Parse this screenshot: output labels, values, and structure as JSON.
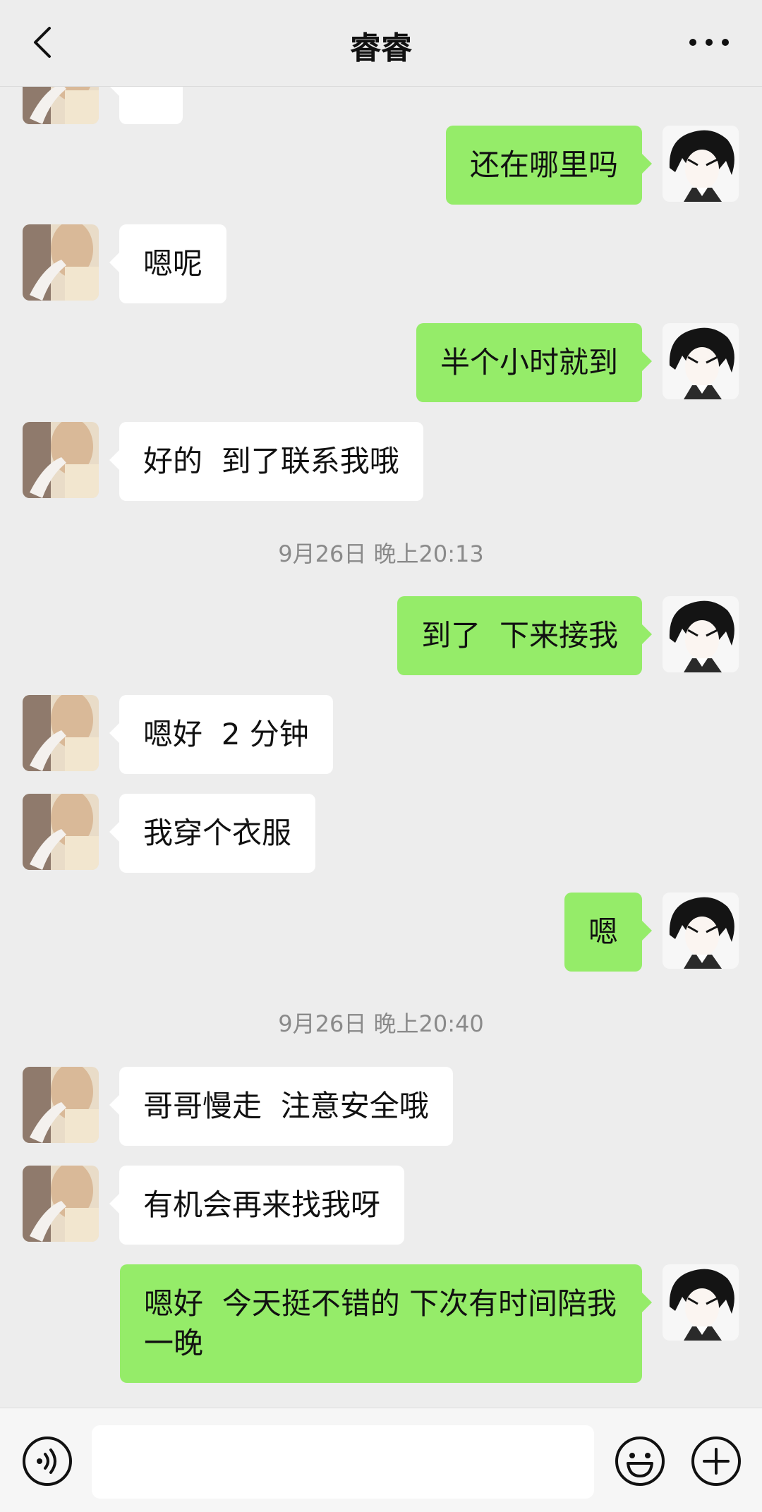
{
  "header": {
    "title": "睿睿",
    "back_icon": "chevron-left-icon",
    "more_icon": "more-dots-icon"
  },
  "messages": [
    {
      "side": "left",
      "text": ""
    },
    {
      "side": "right",
      "text": "还在哪里吗"
    },
    {
      "side": "left",
      "text": "嗯呢"
    },
    {
      "side": "right",
      "text": "半个小时就到"
    },
    {
      "side": "left",
      "text": "好的  到了联系我哦"
    },
    {
      "timestamp": "9月26日 晚上20:13"
    },
    {
      "side": "right",
      "text": "到了  下来接我"
    },
    {
      "side": "left",
      "text": "嗯好  2 分钟"
    },
    {
      "side": "left",
      "text": "我穿个衣服"
    },
    {
      "side": "right",
      "text": "嗯"
    },
    {
      "timestamp": "9月26日 晚上20:40"
    },
    {
      "side": "left",
      "text": "哥哥慢走  注意安全哦"
    },
    {
      "side": "left",
      "text": "有机会再来找我呀"
    },
    {
      "side": "right",
      "text": "嗯好  今天挺不错的 下次有时间陪我一晚"
    }
  ],
  "input_bar": {
    "placeholder": "",
    "voice_icon": "voice-icon",
    "emoji_icon": "emoji-icon",
    "plus_icon": "plus-icon"
  },
  "colors": {
    "background": "#ededed",
    "self_bubble": "#95ec69",
    "other_bubble": "#ffffff",
    "timestamp_text": "#8a8a8a"
  }
}
